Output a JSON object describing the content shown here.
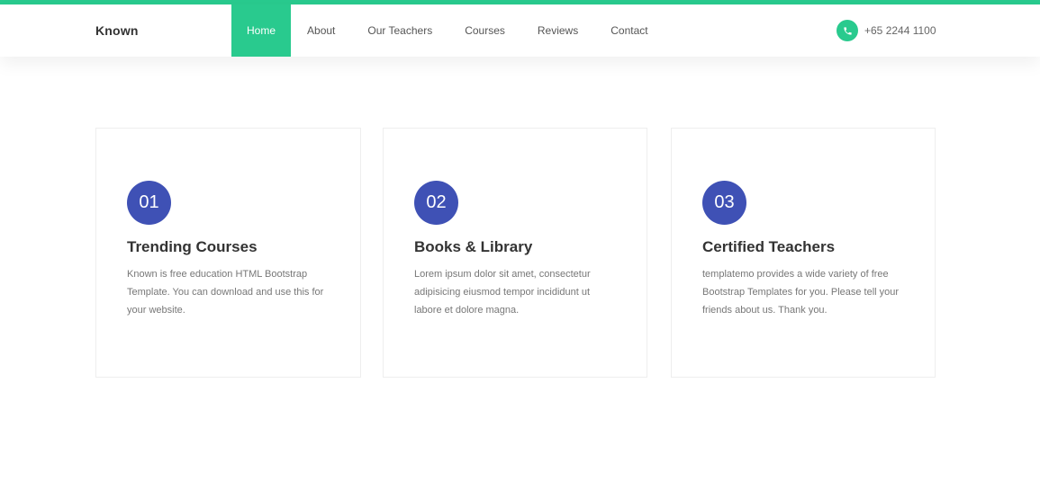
{
  "colors": {
    "accent": "#29ca8e",
    "number_badge": "#3f51b5",
    "heading": "#333333",
    "body_text": "#777777"
  },
  "navbar": {
    "brand": "Known",
    "links": [
      {
        "label": "Home",
        "active": true
      },
      {
        "label": "About",
        "active": false
      },
      {
        "label": "Our Teachers",
        "active": false
      },
      {
        "label": "Courses",
        "active": false
      },
      {
        "label": "Reviews",
        "active": false
      },
      {
        "label": "Contact",
        "active": false
      }
    ],
    "phone_icon": "phone-icon",
    "phone": "+65 2244 1100"
  },
  "features": [
    {
      "number": "01",
      "title": "Trending Courses",
      "text": "Known is free education HTML Bootstrap Template. You can download and use this for your website."
    },
    {
      "number": "02",
      "title": "Books & Library",
      "text": "Lorem ipsum dolor sit amet, consectetur adipisicing eiusmod tempor incididunt ut labore et dolore magna."
    },
    {
      "number": "03",
      "title": "Certified Teachers",
      "text": "templatemo provides a wide variety of free Bootstrap Templates for you. Please tell your friends about us. Thank you."
    }
  ]
}
